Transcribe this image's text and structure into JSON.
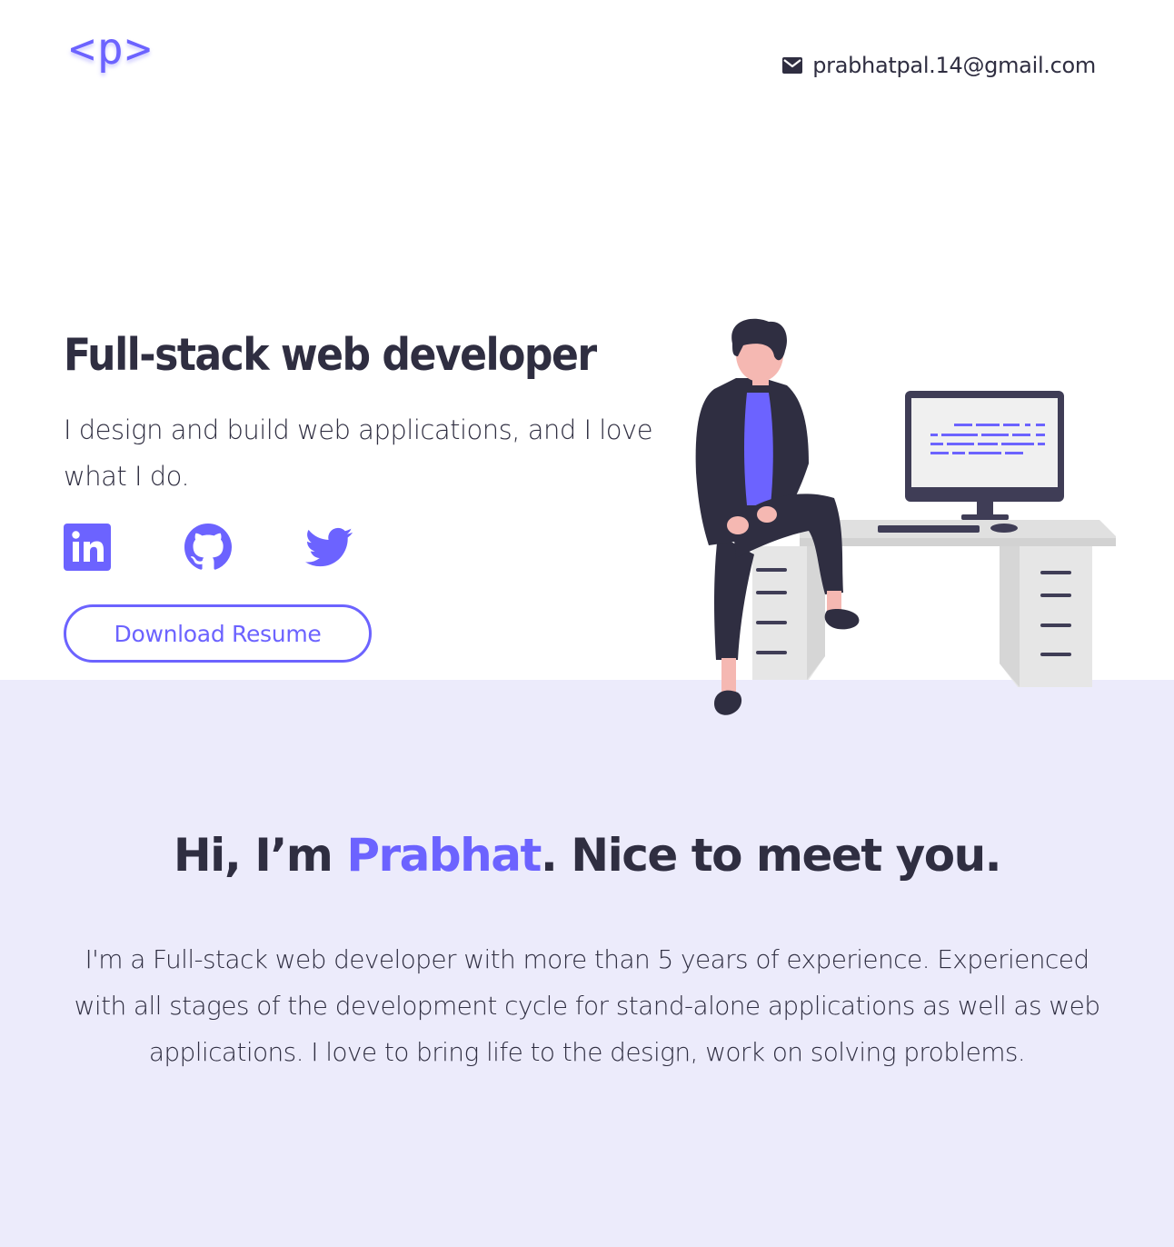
{
  "header": {
    "logo": "<p>",
    "email": "prabhatpal.14@gmail.com",
    "email_icon": "envelope-icon"
  },
  "hero": {
    "title": "Full-stack web developer",
    "subtitle": "I design and build web applications, and I love what I do.",
    "socials": [
      {
        "icon": "linkedin-icon"
      },
      {
        "icon": "github-icon"
      },
      {
        "icon": "twitter-icon"
      }
    ],
    "resume_label": "Download Resume"
  },
  "about": {
    "title_before": "Hi, I’m ",
    "title_name": "Prabhat",
    "title_after": ". Nice to meet you.",
    "text": "I'm a Full-stack web developer with more than 5 years of experience. Experienced with all stages of the development cycle for stand-alone applications as well as web applications. I love to bring life to the design, work on solving problems."
  },
  "colors": {
    "accent": "#6c63ff",
    "text": "#2f2e41",
    "section_bg": "#ecebfb"
  }
}
